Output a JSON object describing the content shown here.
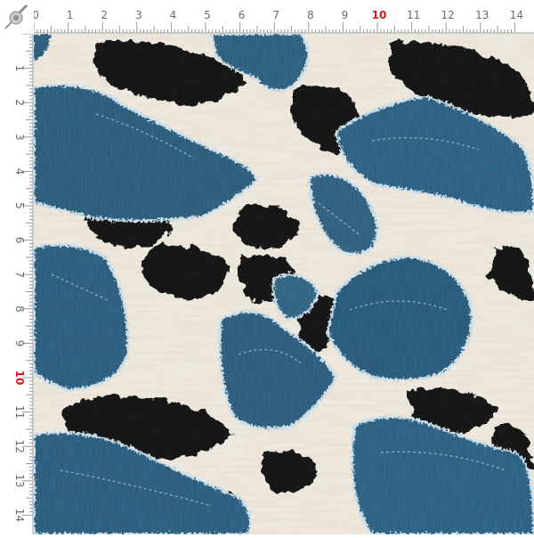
{
  "ruler": {
    "top_labels": [
      "0",
      "1",
      "2",
      "3",
      "4",
      "5",
      "6",
      "7",
      "8",
      "9",
      "10",
      "11",
      "12",
      "13",
      "14"
    ],
    "left_labels": [
      "1",
      "2",
      "3",
      "4",
      "5",
      "6",
      "7",
      "8",
      "9",
      "10",
      "11",
      "12",
      "13",
      "14"
    ],
    "highlight_label": "10",
    "highlight_color": "#d0181f",
    "label_color": "#6b6b6b",
    "tick_color": "#9a9a9a"
  },
  "fabric": {
    "description_colors": {
      "fur_base": "#e9e1d4",
      "fur_shadow": "#b9a68a",
      "spot": "#141516",
      "denim_dark": "#234b63",
      "denim_mid": "#3f6f8d",
      "denim_light": "#8fb4c9",
      "fray": "#c8dbe6"
    }
  },
  "icons": {
    "corner": "pushpin-icon"
  }
}
